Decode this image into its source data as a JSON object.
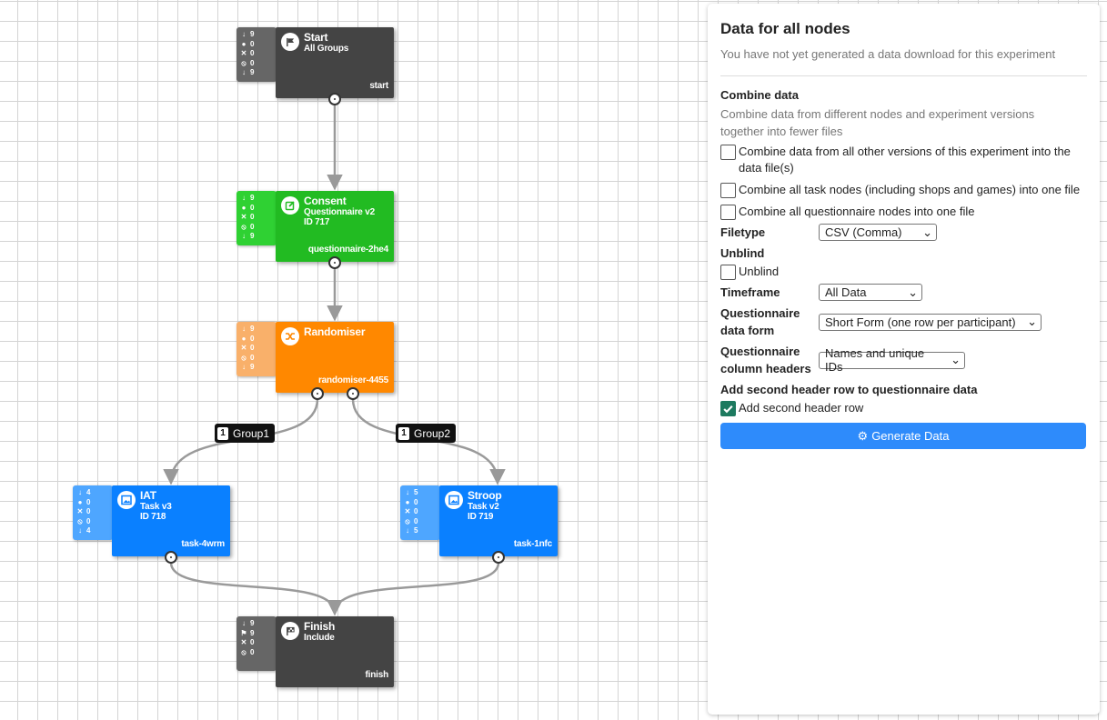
{
  "nodes": {
    "start": {
      "title": "Start",
      "subtitle": "All Groups",
      "key": "start",
      "stats": [
        "9",
        "0",
        "0",
        "0",
        "9"
      ]
    },
    "consent": {
      "title": "Consent",
      "subtitle": "Questionnaire v2",
      "id": "ID 717",
      "key": "questionnaire-2he4",
      "stats": [
        "9",
        "0",
        "0",
        "0",
        "9"
      ]
    },
    "randomiser": {
      "title": "Randomiser",
      "key": "randomiser-4455",
      "stats": [
        "9",
        "0",
        "0",
        "0",
        "9"
      ]
    },
    "iat": {
      "title": "IAT",
      "subtitle": "Task v3",
      "id": "ID 718",
      "key": "task-4wrm",
      "stats": [
        "4",
        "0",
        "0",
        "0",
        "4"
      ]
    },
    "stroop": {
      "title": "Stroop",
      "subtitle": "Task v2",
      "id": "ID 719",
      "key": "task-1nfc",
      "stats": [
        "5",
        "0",
        "0",
        "0",
        "5"
      ]
    },
    "finish": {
      "title": "Finish",
      "subtitle": "Include",
      "key": "finish",
      "stats": [
        "9",
        "9",
        "0",
        "0"
      ]
    }
  },
  "edges": {
    "group1": {
      "badge": "1",
      "label": "Group1"
    },
    "group2": {
      "badge": "1",
      "label": "Group2"
    }
  },
  "panel": {
    "title": "Data for all nodes",
    "no_download": "You have not yet generated a data download for this experiment",
    "combine_title": "Combine data",
    "combine_desc": "Combine data from different nodes and experiment versions together into fewer files",
    "combine_versions": "Combine data from all other versions of this experiment into the data file(s)",
    "combine_tasks": "Combine all task nodes (including shops and games) into one file",
    "combine_questionnaires": "Combine all questionnaire nodes into one file",
    "filetype_label": "Filetype",
    "filetype_value": "CSV (Comma)",
    "unblind_title": "Unblind",
    "unblind_label": "Unblind",
    "timeframe_label": "Timeframe",
    "timeframe_value": "All Data",
    "qform_label": "Questionnaire data form",
    "qform_value": "Short Form (one row per participant)",
    "qheaders_label": "Questionnaire column headers",
    "qheaders_value": "Names and unique IDs",
    "second_header_title": "Add second header row to questionnaire data",
    "second_header_label": "Add second header row",
    "generate_label": "Generate Data"
  },
  "colors": {
    "start": "#444444",
    "consent": "#22bb22",
    "randomiser": "#ff8800",
    "task": "#0a80ff",
    "finish": "#444444",
    "primary_button": "#2e8bfb",
    "checked": "#1d7a5f"
  }
}
